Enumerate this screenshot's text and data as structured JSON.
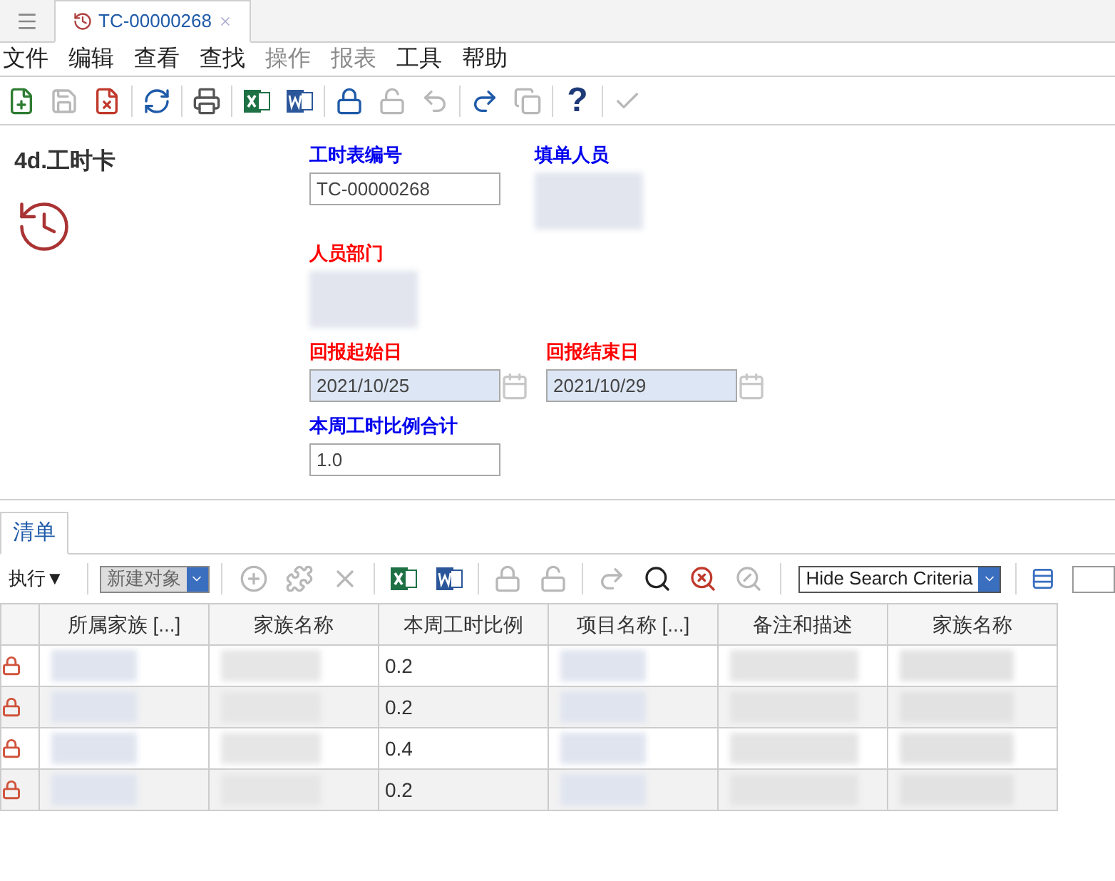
{
  "tab": {
    "title": "TC-00000268",
    "selected": true
  },
  "menu": [
    {
      "label": "文件",
      "disabled": false
    },
    {
      "label": "编辑",
      "disabled": false
    },
    {
      "label": "查看",
      "disabled": false
    },
    {
      "label": "查找",
      "disabled": false
    },
    {
      "label": "操作",
      "disabled": true
    },
    {
      "label": "报表",
      "disabled": true
    },
    {
      "label": "工具",
      "disabled": false
    },
    {
      "label": "帮助",
      "disabled": false
    }
  ],
  "toolbar": [
    {
      "kind": "new",
      "disabled": false
    },
    {
      "kind": "save",
      "disabled": true
    },
    {
      "kind": "delete",
      "disabled": false,
      "sep": true
    },
    {
      "kind": "refresh",
      "disabled": false,
      "sep": true
    },
    {
      "kind": "print",
      "disabled": false,
      "sep": true
    },
    {
      "kind": "excel",
      "disabled": false
    },
    {
      "kind": "word",
      "disabled": false,
      "sep": true
    },
    {
      "kind": "lock",
      "disabled": false
    },
    {
      "kind": "unlock",
      "disabled": true
    },
    {
      "kind": "undo",
      "disabled": true,
      "sep": true
    },
    {
      "kind": "route",
      "disabled": false
    },
    {
      "kind": "copy",
      "disabled": true,
      "sep": true
    },
    {
      "kind": "help",
      "disabled": false,
      "sep": true,
      "label": "?"
    },
    {
      "kind": "check",
      "disabled": true
    }
  ],
  "form": {
    "title": "4d.工时卡",
    "fields": [
      {
        "label": "工时表编号",
        "value": "TC-00000268",
        "kind": "text",
        "required": false
      },
      {
        "label": "填单人员",
        "kind": "blurred",
        "required": false
      },
      {
        "label": "人员部门",
        "kind": "blurred",
        "required": true
      },
      {
        "label": "回报起始日",
        "value": "2021/10/25",
        "kind": "date",
        "required": true
      },
      {
        "label": "回报结束日",
        "value": "2021/10/29",
        "kind": "date",
        "required": true
      },
      {
        "label": "本周工时比例合计",
        "value": "1.0",
        "kind": "text",
        "required": false
      }
    ]
  },
  "list_tab": {
    "title": "清单",
    "selected": true
  },
  "list_toolbar": {
    "execute": "执行▼",
    "new_object": "新建对象",
    "search_toggle": "Hide Search Criteria",
    "icons": [
      {
        "kind": "add",
        "disabled": true
      },
      {
        "kind": "puzzle",
        "disabled": true
      },
      {
        "kind": "remove",
        "disabled": true,
        "sep": true
      },
      {
        "kind": "excel",
        "disabled": false
      },
      {
        "kind": "word",
        "disabled": false,
        "sep": true
      },
      {
        "kind": "lock",
        "disabled": true
      },
      {
        "kind": "unlock",
        "disabled": true,
        "sep": true
      },
      {
        "kind": "route",
        "disabled": true
      },
      {
        "kind": "search-run",
        "disabled": false
      },
      {
        "kind": "search-clear",
        "disabled": false
      },
      {
        "kind": "search-off",
        "disabled": true
      }
    ]
  },
  "table": {
    "columns": [
      "所属家族 [...]",
      "家族名称",
      "本周工时比例",
      "项目名称 [...]",
      "备注和描述",
      "家族名称"
    ],
    "rows": [
      {
        "locked": true,
        "ratio": "0.2"
      },
      {
        "locked": true,
        "ratio": "0.2"
      },
      {
        "locked": true,
        "ratio": "0.4"
      },
      {
        "locked": true,
        "ratio": "0.2"
      }
    ]
  }
}
